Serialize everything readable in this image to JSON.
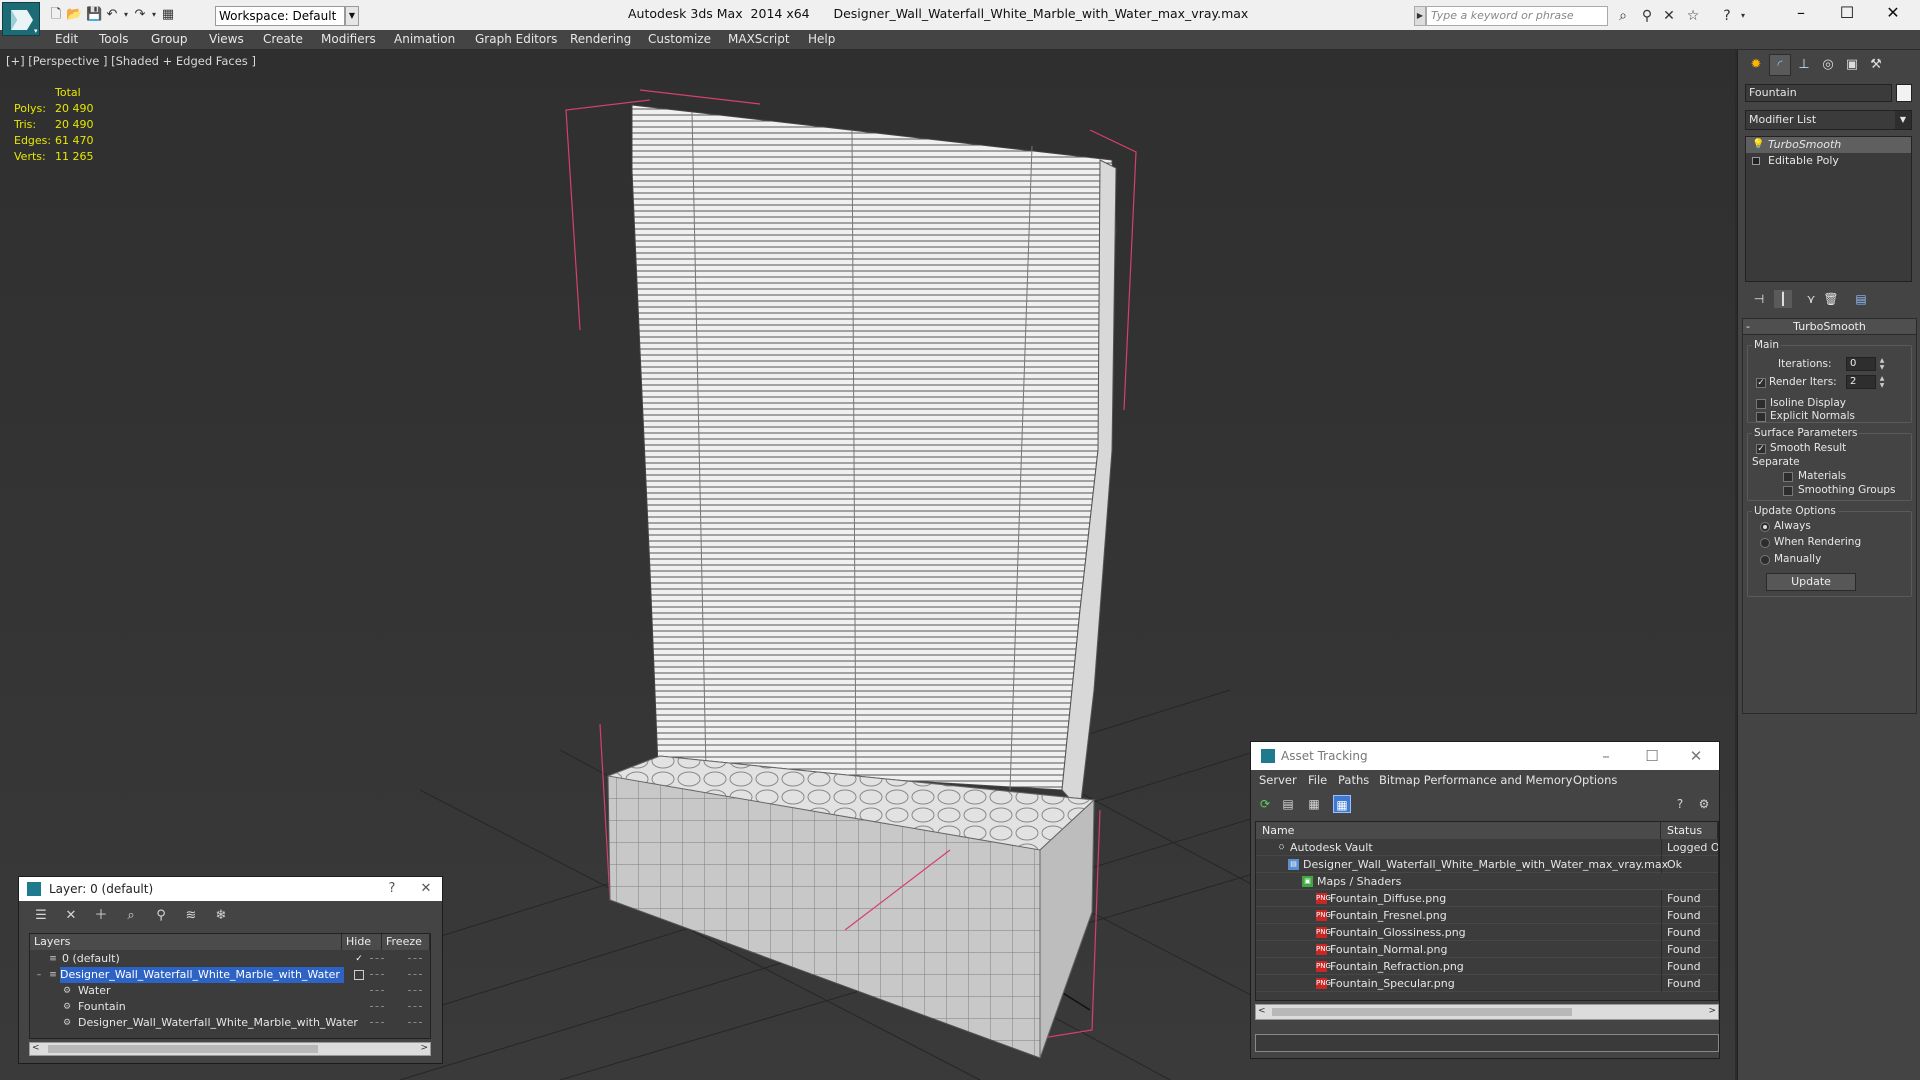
{
  "titlebar": {
    "app_title": "Autodesk 3ds Max  2014 x64",
    "file_title": "Designer_Wall_Waterfall_White_Marble_with_Water_max_vray.max",
    "workspace_label": "Workspace: Default",
    "search_placeholder": "Type a keyword or phrase",
    "minimize": "–",
    "maximize": "☐",
    "close": "✕"
  },
  "menubar": {
    "items": [
      "Edit",
      "Tools",
      "Group",
      "Views",
      "Create",
      "Modifiers",
      "Animation",
      "Graph Editors",
      "Rendering",
      "Customize",
      "MAXScript",
      "Help"
    ]
  },
  "viewport": {
    "label": "[+] [Perspective ] [Shaded + Edged Faces ]",
    "stats": {
      "header": "Total",
      "rows": [
        {
          "label": "Polys:",
          "value": "20 490"
        },
        {
          "label": "Tris:",
          "value": "20 490"
        },
        {
          "label": "Edges:",
          "value": "61 470"
        },
        {
          "label": "Verts:",
          "value": "11 265"
        }
      ]
    }
  },
  "command_panel": {
    "object_name": "Fountain",
    "object_color": "#f2f2f2",
    "modifier_list": "Modifier List",
    "stack": [
      "TurboSmooth",
      "Editable Poly"
    ],
    "rollout_title": "TurboSmooth",
    "main": {
      "title": "Main",
      "iterations_label": "Iterations:",
      "iterations_value": "0",
      "render_iters_label": "Render Iters:",
      "render_iters_value": "2",
      "render_iters_checked": true,
      "isoline_label": "Isoline Display",
      "isoline_checked": false,
      "explicit_normals_label": "Explicit Normals",
      "explicit_normals_checked": false
    },
    "surface": {
      "title": "Surface Parameters",
      "smooth_result_label": "Smooth Result",
      "smooth_result_checked": true,
      "separate_label": "Separate",
      "materials_label": "Materials",
      "smoothing_groups_label": "Smoothing Groups"
    },
    "update": {
      "title": "Update Options",
      "options": [
        "Always",
        "When Rendering",
        "Manually"
      ],
      "selected": "Always",
      "button": "Update"
    }
  },
  "layer_window": {
    "title": "Layer: 0 (default)",
    "help": "?",
    "close": "✕",
    "columns": [
      "Layers",
      "Hide",
      "Freeze"
    ],
    "rows": [
      {
        "name": "0 (default)",
        "indent": 1,
        "selected": false
      },
      {
        "name": "Designer_Wall_Waterfall_White_Marble_with_Water",
        "indent": 1,
        "selected": true
      },
      {
        "name": "Water",
        "indent": 2,
        "selected": false
      },
      {
        "name": "Fountain",
        "indent": 2,
        "selected": false
      },
      {
        "name": "Designer_Wall_Waterfall_White_Marble_with_Water",
        "indent": 2,
        "selected": false
      }
    ]
  },
  "asset_window": {
    "title": "Asset Tracking",
    "menus": [
      "Server",
      "File",
      "Paths",
      "Bitmap Performance and Memory",
      "Options"
    ],
    "columns": [
      "Name",
      "Status"
    ],
    "rows": [
      {
        "name": "Autodesk Vault",
        "status": "Logged Out",
        "indent": 1,
        "icon": "vault"
      },
      {
        "name": "Designer_Wall_Waterfall_White_Marble_with_Water_max_vray.max",
        "status": "Ok",
        "indent": 2,
        "icon": "max"
      },
      {
        "name": "Maps / Shaders",
        "status": "",
        "indent": 3,
        "icon": "maps"
      },
      {
        "name": "Fountain_Diffuse.png",
        "status": "Found",
        "indent": 4,
        "icon": "png"
      },
      {
        "name": "Fountain_Fresnel.png",
        "status": "Found",
        "indent": 4,
        "icon": "png"
      },
      {
        "name": "Fountain_Glossiness.png",
        "status": "Found",
        "indent": 4,
        "icon": "png"
      },
      {
        "name": "Fountain_Normal.png",
        "status": "Found",
        "indent": 4,
        "icon": "png"
      },
      {
        "name": "Fountain_Refraction.png",
        "status": "Found",
        "indent": 4,
        "icon": "png"
      },
      {
        "name": "Fountain_Specular.png",
        "status": "Found",
        "indent": 4,
        "icon": "png"
      }
    ]
  },
  "colors": {
    "stats_text": "#e7e700",
    "selection_blue": "#2d63c5",
    "bounding_box": "#d6406a"
  }
}
